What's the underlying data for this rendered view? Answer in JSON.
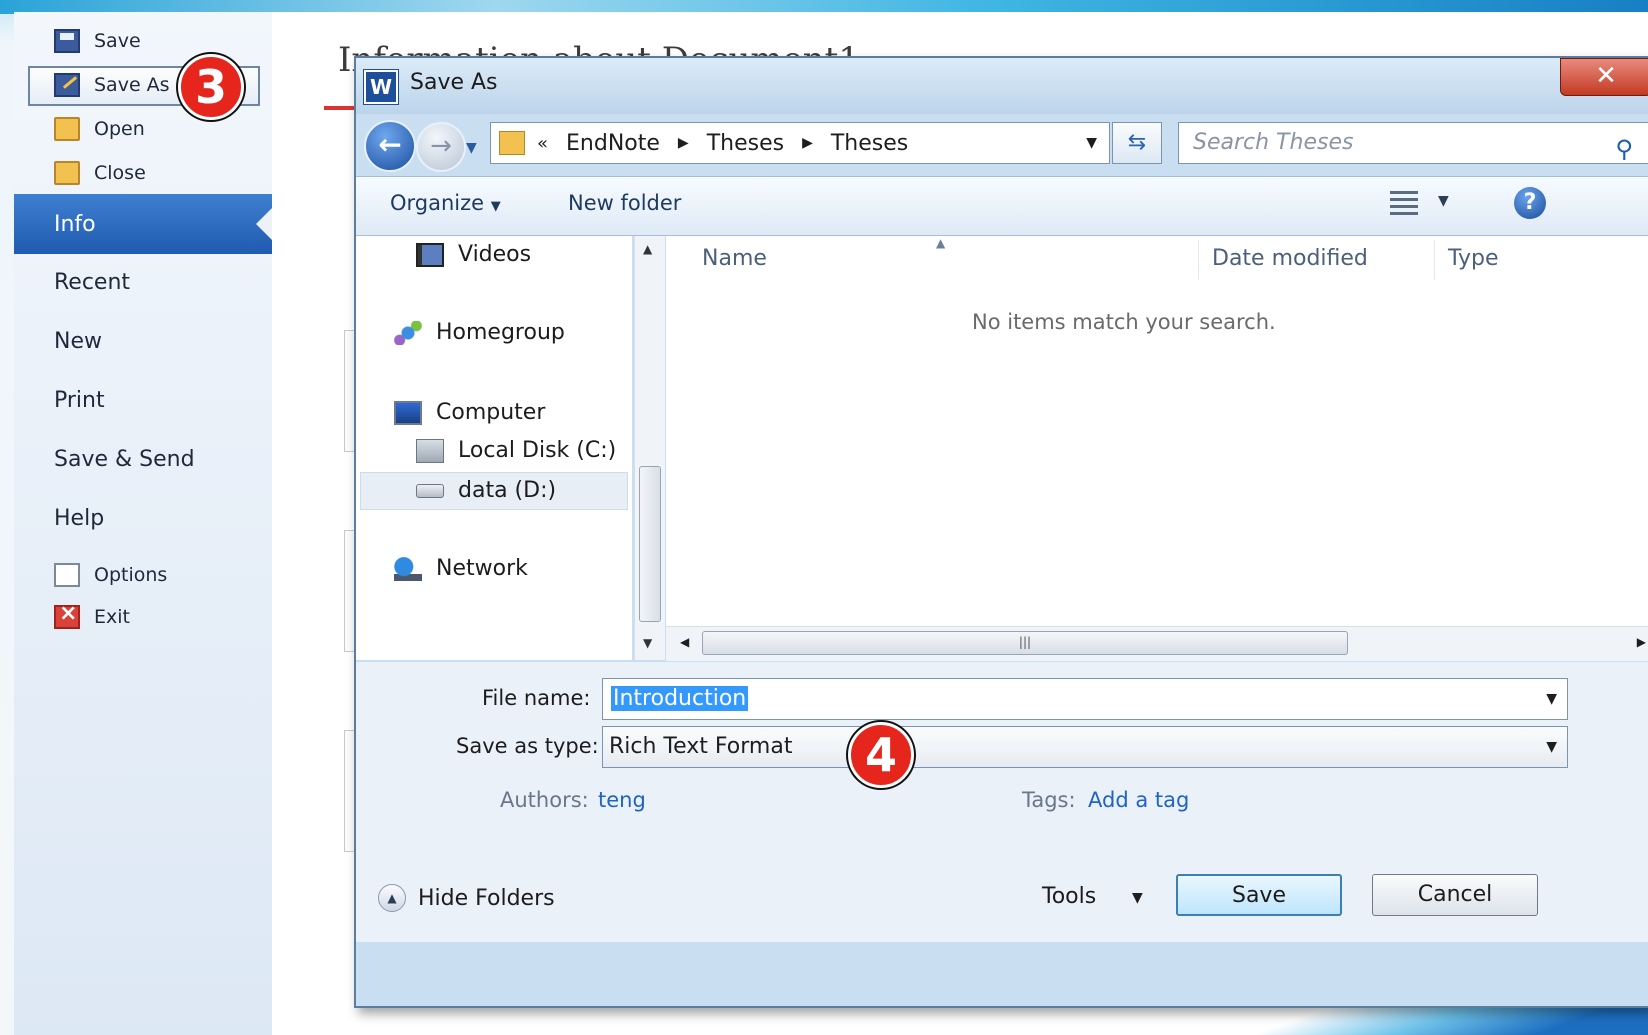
{
  "backstage": {
    "commands": [
      {
        "label": "Save",
        "icon": "save-icon"
      },
      {
        "label": "Save As",
        "icon": "save-as-icon"
      },
      {
        "label": "Open",
        "icon": "open-folder-icon"
      },
      {
        "label": "Close",
        "icon": "close-folder-icon"
      }
    ],
    "tabs": [
      "Info",
      "Recent",
      "New",
      "Print",
      "Save & Send",
      "Help"
    ],
    "active_tab": "Info",
    "bottom_commands": [
      {
        "label": "Options",
        "icon": "options-icon"
      },
      {
        "label": "Exit",
        "icon": "exit-icon"
      }
    ]
  },
  "info_area": {
    "title_partial": "Information about Document1"
  },
  "callouts": {
    "step3": "3",
    "step4": "4"
  },
  "dialog": {
    "title": "Save As",
    "close_glyph": "✕",
    "address": {
      "overflow": "«",
      "crumbs": [
        "EndNote",
        "Theses",
        "Theses"
      ]
    },
    "search_placeholder": "Search Theses",
    "toolbar": {
      "organize": "Organize",
      "new_folder": "New folder"
    },
    "nav_pane": {
      "items": [
        {
          "label": "Videos",
          "icon": "videos-icon"
        },
        {
          "label": "Homegroup",
          "icon": "homegroup-icon"
        },
        {
          "label": "Computer",
          "icon": "computer-icon"
        },
        {
          "label": "Local Disk (C:)",
          "icon": "local-disk-icon"
        },
        {
          "label": "data (D:)",
          "icon": "drive-icon",
          "selected": true
        },
        {
          "label": "Network",
          "icon": "network-icon"
        }
      ]
    },
    "file_list": {
      "columns": [
        "Name",
        "Date modified",
        "Type"
      ],
      "empty_message": "No items match your search."
    },
    "form": {
      "file_name_label": "File name:",
      "file_name_value": "Introduction",
      "save_type_label": "Save as type:",
      "save_type_value": "Rich Text Format",
      "authors_label": "Authors:",
      "authors_value": "teng",
      "tags_label": "Tags:",
      "tags_value": "Add a tag"
    },
    "footer": {
      "hide_folders": "Hide Folders",
      "tools": "Tools",
      "save": "Save",
      "cancel": "Cancel"
    }
  },
  "colors": {
    "backstage_active": "#1f5bb0",
    "callout": "#e6251d",
    "link": "#1f63c6",
    "selection": "#3399ff"
  }
}
